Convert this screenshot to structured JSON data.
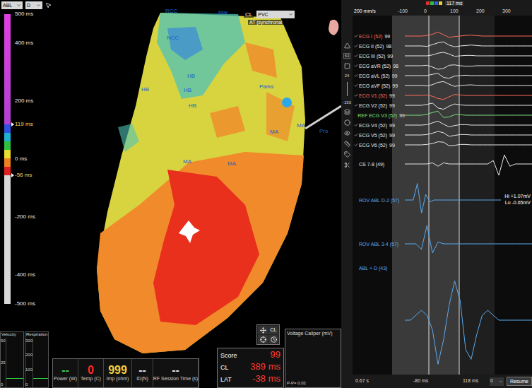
{
  "toolbar": {
    "channel": "ABL",
    "mode": "D"
  },
  "scale": {
    "ticks": [
      {
        "label": "500 ms",
        "value": 500,
        "highlight": false
      },
      {
        "label": "400 ms",
        "value": 400,
        "highlight": false
      },
      {
        "label": "200 ms",
        "value": 200,
        "highlight": false
      },
      {
        "label": "119 ms",
        "value": 119,
        "highlight": true
      },
      {
        "label": "0 ms",
        "value": 0,
        "highlight": false
      },
      {
        "label": "-56 ms",
        "value": -56,
        "highlight": true
      },
      {
        "label": "-200 ms",
        "value": -200,
        "highlight": false
      },
      {
        "label": "-400 ms",
        "value": -400,
        "highlight": false
      },
      {
        "label": "-500 ms",
        "value": -500,
        "highlight": false
      }
    ]
  },
  "map": {
    "caption": "CL",
    "view": "PVC",
    "subtitle": "AT (synchronal",
    "labels": [
      "Mar",
      "RCC",
      "NCC",
      "HB",
      "HB",
      "HB",
      "HB",
      "Parks",
      "MA",
      "MA",
      "MA",
      "MA",
      "Pro"
    ]
  },
  "side_toolbar": {
    "values": [
      "63",
      "24",
      "-150"
    ]
  },
  "traces": {
    "speed": "200 mm/s",
    "window": "117 ms",
    "time_ticks": [
      "-100",
      "0",
      "100",
      "200",
      "300"
    ],
    "channels": [
      {
        "label": "ECG I (52)",
        "score": "99",
        "checked": true,
        "kind": "ecg",
        "color": "#ff6a5a",
        "wave": [
          0,
          0,
          0,
          0,
          0.1,
          0.4,
          0.9,
          0.3,
          -0.3,
          -0.1,
          0,
          0.15,
          0.2,
          0.1,
          0,
          0,
          0,
          0,
          0,
          0,
          0,
          0,
          0,
          0
        ]
      },
      {
        "label": "ECG II (52)",
        "score": "98",
        "checked": true,
        "kind": "ecg",
        "color": "#e8e8e8",
        "wave": [
          0,
          0,
          0,
          0,
          -0.1,
          0.3,
          0.7,
          0.9,
          0.2,
          -0.2,
          0,
          0.1,
          0.2,
          0.1,
          0,
          0,
          0,
          0,
          0,
          0,
          0,
          0,
          0,
          0
        ]
      },
      {
        "label": "ECG III (52)",
        "score": "99",
        "checked": true,
        "kind": "ecg",
        "color": "#e8e8e8",
        "wave": [
          0,
          0,
          0,
          0,
          0,
          0.2,
          0.6,
          0.8,
          0.4,
          -0.1,
          0,
          0.1,
          0.1,
          0,
          0,
          0,
          0,
          0,
          0,
          0,
          0,
          0,
          0,
          0
        ]
      },
      {
        "label": "ECG aVR (52)",
        "score": "98",
        "checked": true,
        "kind": "ecg",
        "color": "#e8e8e8",
        "wave": [
          0,
          0,
          0,
          0,
          0.1,
          -0.3,
          -0.8,
          -0.6,
          0.1,
          0.2,
          0,
          -0.1,
          -0.1,
          0,
          0,
          0,
          0,
          0,
          0,
          0,
          0,
          0,
          0,
          0
        ]
      },
      {
        "label": "ECG aVL (52)",
        "score": "99",
        "checked": true,
        "kind": "ecg",
        "color": "#e8e8e8",
        "wave": [
          0,
          0,
          0,
          0,
          0,
          0.3,
          0.5,
          -0.4,
          -0.6,
          -0.1,
          0,
          0.1,
          0,
          0,
          0,
          0,
          0,
          0,
          0,
          0,
          0,
          0,
          0,
          0
        ]
      },
      {
        "label": "ECG aVF (52)",
        "score": "99",
        "checked": true,
        "kind": "ecg",
        "color": "#e8e8e8",
        "wave": [
          0,
          0,
          0,
          0,
          -0.1,
          0.2,
          0.7,
          0.9,
          0.3,
          -0.2,
          0,
          0.1,
          0.15,
          0.05,
          0,
          0,
          0,
          0,
          0,
          0,
          0,
          0,
          0,
          0
        ]
      },
      {
        "label": "ECG V1 (52)",
        "score": "99",
        "checked": true,
        "kind": "ecg",
        "color": "#ff6a5a",
        "wave": [
          0,
          0,
          0,
          0,
          0.1,
          -0.2,
          -0.7,
          -0.9,
          -0.3,
          0.2,
          0.1,
          0,
          0,
          0,
          0,
          0,
          0,
          0,
          0,
          0,
          0,
          0,
          0,
          0
        ]
      },
      {
        "label": "ECG V2 (52)",
        "score": "99",
        "checked": true,
        "kind": "ecg",
        "color": "#e8e8e8",
        "wave": [
          0,
          0,
          0,
          0,
          0.2,
          0.5,
          -0.6,
          -0.9,
          -0.2,
          0.3,
          0.1,
          0,
          0,
          0,
          0,
          0,
          0,
          0,
          0,
          0,
          0,
          0,
          0,
          0
        ]
      },
      {
        "label": "REF ECG V3 (52)",
        "score": "99",
        "checked": false,
        "kind": "ecg",
        "color": "#7ee07e",
        "wave": [
          0,
          0,
          0,
          0,
          0.2,
          0.6,
          0.9,
          -0.5,
          -0.4,
          0.1,
          0.1,
          0,
          0,
          0,
          0,
          0,
          0,
          0,
          0,
          0,
          0,
          0,
          0,
          0
        ]
      },
      {
        "label": "ECG V4 (52)",
        "score": "99",
        "checked": true,
        "kind": "ecg",
        "color": "#e8e8e8",
        "wave": [
          0,
          0,
          0,
          0,
          0.1,
          0.5,
          0.9,
          0.2,
          -0.4,
          -0.1,
          0.1,
          0.1,
          0,
          0,
          0,
          0,
          0,
          0,
          0,
          0,
          0,
          0,
          0,
          0
        ]
      },
      {
        "label": "ECG V5 (52)",
        "score": "99",
        "checked": true,
        "kind": "ecg",
        "color": "#e8e8e8",
        "wave": [
          0,
          0,
          0,
          0,
          0.1,
          0.4,
          0.8,
          0.5,
          -0.3,
          -0.1,
          0.1,
          0.1,
          0,
          0,
          0,
          0,
          0,
          0,
          0,
          0,
          0,
          0,
          0,
          0
        ]
      },
      {
        "label": "ECG V6 (52)",
        "score": "99",
        "checked": true,
        "kind": "ecg",
        "color": "#e8e8e8",
        "wave": [
          0,
          0,
          0,
          0,
          0.1,
          0.3,
          0.7,
          0.6,
          -0.2,
          -0.1,
          0.1,
          0.1,
          0,
          0,
          0,
          0,
          0,
          0,
          0,
          0,
          0,
          0,
          0,
          0
        ]
      },
      {
        "label": "CS 7-8 (49)",
        "score": "",
        "checked": false,
        "kind": "cs",
        "color": "#e8e8e8",
        "wave": [
          0,
          0,
          0,
          0,
          0,
          0.1,
          -0.2,
          0.1,
          0,
          0,
          0,
          0,
          0,
          0,
          0,
          0,
          0.3,
          -1,
          0.8,
          -0.2,
          0,
          0,
          0,
          0
        ]
      },
      {
        "label": "ROV ABL D-2 (57)",
        "score": "",
        "checked": false,
        "kind": "rov",
        "color": "#5aaaf0",
        "wave": [
          0,
          0,
          0,
          0.9,
          -0.7,
          0.3,
          -0.1,
          0,
          0,
          0,
          0,
          0,
          0,
          0,
          0,
          0,
          0,
          0,
          0,
          0,
          0,
          0,
          0,
          0
        ],
        "hi": "Hi +1.07mV",
        "lo": "Lo -0.65mV"
      },
      {
        "label": "ROV ABL 3-4 (57)",
        "score": "",
        "checked": false,
        "kind": "rov",
        "color": "#5aaaf0",
        "wave": [
          0,
          0,
          0,
          -0.3,
          1,
          -0.5,
          0.1,
          0,
          0,
          0,
          0,
          0,
          0,
          0,
          0,
          0,
          0,
          0,
          0,
          0,
          0,
          0,
          0,
          0
        ]
      },
      {
        "label": "ABL + D (43)",
        "score": "",
        "checked": false,
        "kind": "abl",
        "color": "#5aaaf0",
        "wave": [
          0,
          0,
          0.1,
          0.2,
          0.1,
          -0.2,
          -0.9,
          -0.4,
          0.3,
          0.8,
          0.4,
          -0.6,
          -0.8,
          -0.3,
          0.1,
          0.2,
          0.1,
          0,
          0,
          0,
          0,
          0,
          0,
          0
        ]
      }
    ],
    "footer": {
      "duration": "0.67 s",
      "left": "-80 ms",
      "right": "118 ms",
      "select": "0",
      "button": "Resume"
    }
  },
  "velocity": {
    "label": "Velocity",
    "ticks": [
      "50",
      "25",
      "0"
    ]
  },
  "respiration": {
    "label": "Respiration",
    "ticks": [
      "300",
      "200",
      "100",
      "0"
    ]
  },
  "ablation": [
    {
      "value": "--",
      "label": "Power (W)",
      "color": "#3ec94a"
    },
    {
      "value": "0",
      "label": "Temp (C)",
      "color": "#ff2a2a"
    },
    {
      "value": "999",
      "label": "Imp (ohm)",
      "color": "#f0d040"
    },
    {
      "value": "--",
      "label": "ID(N)",
      "color": "#e0e0e0"
    },
    {
      "value": "--",
      "label": "RF Session Time (s)",
      "color": "#e0e0e0"
    }
  ],
  "view_buttons": [
    "CL"
  ],
  "score": [
    {
      "label": "Score",
      "value": "99"
    },
    {
      "label": "CL",
      "value": "389 ms"
    },
    {
      "label": "LAT",
      "value": "-38 ms"
    }
  ],
  "caliper": {
    "title": "Voltage Caliper (mV)",
    "reading": "P-P= 0.02"
  }
}
